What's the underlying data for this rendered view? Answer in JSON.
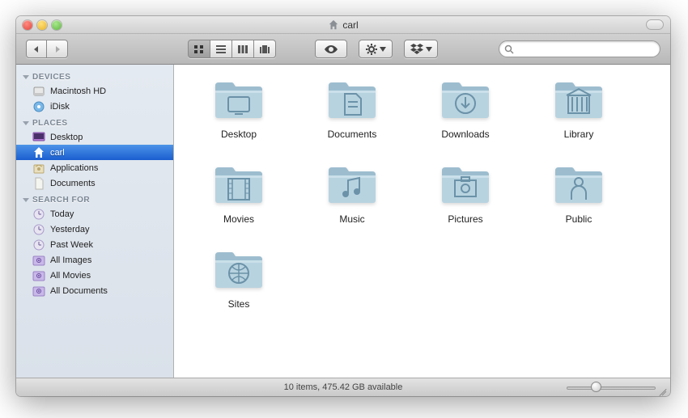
{
  "title": "carl",
  "sidebar": {
    "sections": [
      {
        "header": "DEVICES",
        "items": [
          {
            "label": "Macintosh HD",
            "icon": "hdd",
            "selected": false
          },
          {
            "label": "iDisk",
            "icon": "idisk",
            "selected": false
          }
        ]
      },
      {
        "header": "PLACES",
        "items": [
          {
            "label": "Desktop",
            "icon": "desktop",
            "selected": false
          },
          {
            "label": "carl",
            "icon": "home",
            "selected": true
          },
          {
            "label": "Applications",
            "icon": "apps",
            "selected": false
          },
          {
            "label": "Documents",
            "icon": "docs",
            "selected": false
          }
        ]
      },
      {
        "header": "SEARCH FOR",
        "items": [
          {
            "label": "Today",
            "icon": "clock",
            "selected": false
          },
          {
            "label": "Yesterday",
            "icon": "clock",
            "selected": false
          },
          {
            "label": "Past Week",
            "icon": "clock",
            "selected": false
          },
          {
            "label": "All Images",
            "icon": "smart",
            "selected": false
          },
          {
            "label": "All Movies",
            "icon": "smart",
            "selected": false
          },
          {
            "label": "All Documents",
            "icon": "smart",
            "selected": false
          }
        ]
      }
    ]
  },
  "folders": [
    {
      "label": "Desktop",
      "glyph": "desktop"
    },
    {
      "label": "Documents",
      "glyph": "documents"
    },
    {
      "label": "Downloads",
      "glyph": "downloads"
    },
    {
      "label": "Library",
      "glyph": "library"
    },
    {
      "label": "Movies",
      "glyph": "movies"
    },
    {
      "label": "Music",
      "glyph": "music"
    },
    {
      "label": "Pictures",
      "glyph": "pictures"
    },
    {
      "label": "Public",
      "glyph": "public"
    },
    {
      "label": "Sites",
      "glyph": "sites"
    }
  ],
  "status": "10 items, 475.42 GB available",
  "search": {
    "placeholder": ""
  }
}
